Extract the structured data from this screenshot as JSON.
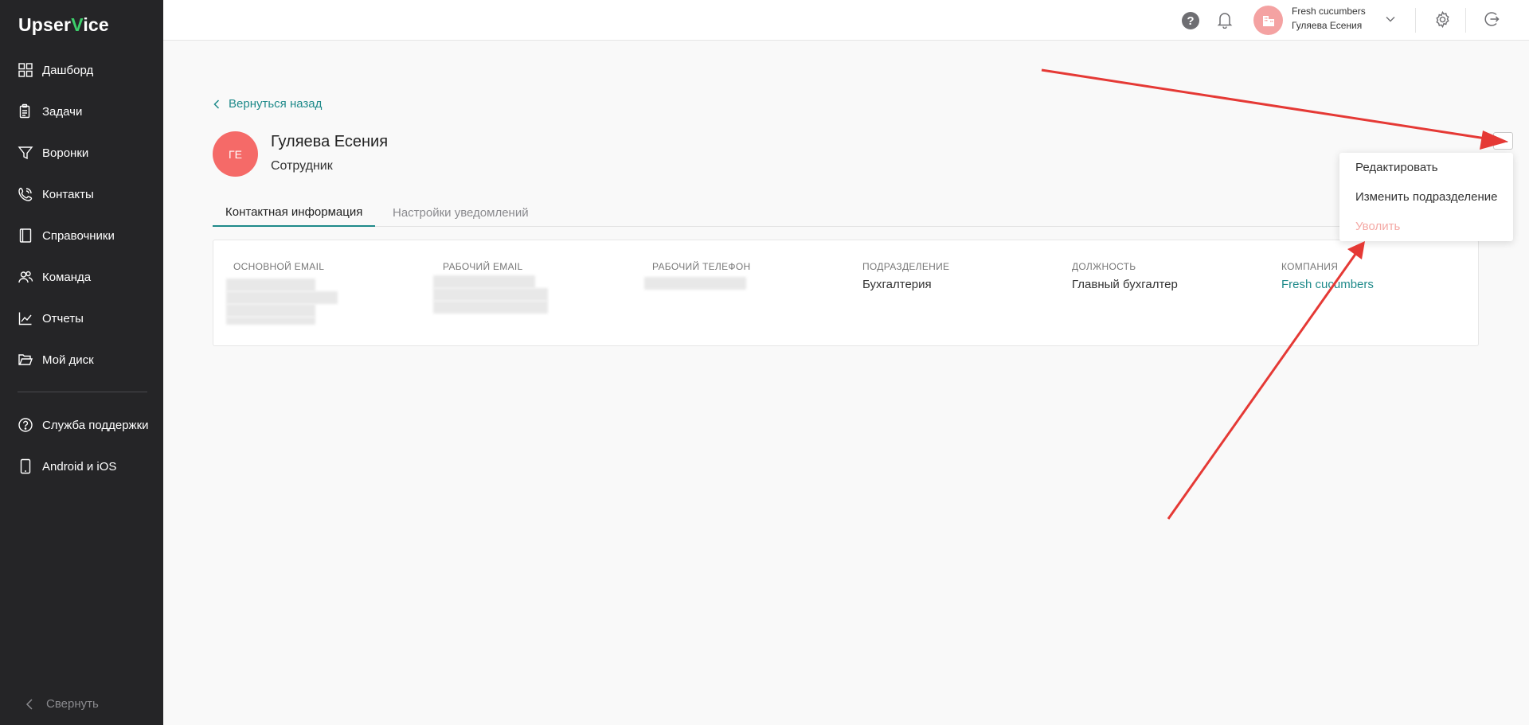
{
  "app": {
    "logo_left": "Upser",
    "logo_v": "V",
    "logo_right": "ice"
  },
  "sidebar": {
    "items": [
      {
        "label": "Дашборд",
        "icon": "dashboard-icon"
      },
      {
        "label": "Задачи",
        "icon": "tasks-icon"
      },
      {
        "label": "Воронки",
        "icon": "funnel-icon"
      },
      {
        "label": "Контакты",
        "icon": "contacts-icon"
      },
      {
        "label": "Справочники",
        "icon": "book-icon"
      },
      {
        "label": "Команда",
        "icon": "team-icon"
      },
      {
        "label": "Отчеты",
        "icon": "reports-icon"
      },
      {
        "label": "Мой диск",
        "icon": "folder-icon"
      }
    ],
    "bottom_items": [
      {
        "label": "Служба поддержки",
        "icon": "help-circle-icon"
      },
      {
        "label": "Android и iOS",
        "icon": "mobile-icon"
      }
    ],
    "collapse_label": "Свернуть"
  },
  "topbar": {
    "help_glyph": "?",
    "company_name": "Fresh cucumbers",
    "user_name": "Гуляева Есения"
  },
  "page": {
    "back_label": "Вернуться назад",
    "avatar_initials": "ГЕ",
    "name": "Гуляева Есения",
    "role": "Сотрудник",
    "tabs": [
      {
        "label": "Контактная информация",
        "active": true
      },
      {
        "label": "Настройки уведомлений",
        "active": false
      }
    ],
    "fields": [
      {
        "label": "ОСНОВНОЙ EMAIL",
        "value": ""
      },
      {
        "label": "РАБОЧИЙ EMAIL",
        "value": ""
      },
      {
        "label": "РАБОЧИЙ ТЕЛЕФОН",
        "value": ""
      },
      {
        "label": "ПОДРАЗДЕЛЕНИЕ",
        "value": "Бухгалтерия"
      },
      {
        "label": "ДОЛЖНОСТЬ",
        "value": "Главный бухгалтер"
      },
      {
        "label": "КОМПАНИЯ",
        "value": "Fresh cucumbers"
      }
    ],
    "more_glyph": "···",
    "menu": [
      {
        "label": "Редактировать",
        "disabled": false
      },
      {
        "label": "Изменить подразделение",
        "disabled": false
      },
      {
        "label": "Уволить",
        "disabled": true
      }
    ]
  },
  "colors": {
    "accent": "#1f8a8a",
    "sidebar_bg": "#252527",
    "avatar": "#f56a68",
    "danger_light": "#f4a9a5",
    "arrow": "#e53935",
    "logo_check": "#3ccf6a"
  }
}
